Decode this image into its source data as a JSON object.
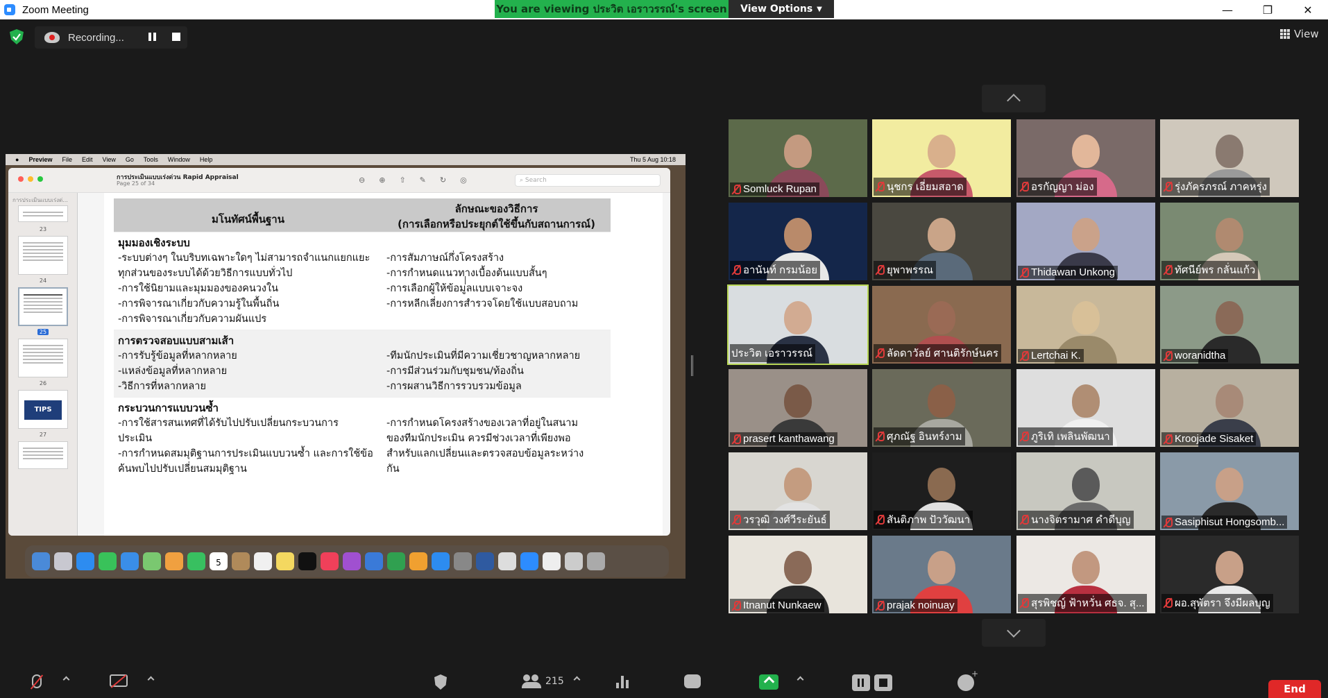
{
  "window": {
    "title": "Zoom Meeting",
    "minimize": "—",
    "restore": "❐",
    "close": "✕"
  },
  "banner": {
    "viewing_text": "You are viewing ประวิต  เอราวรรณ์'s screen",
    "view_options": "View Options",
    "viewing_color": "#23b14d"
  },
  "recording": {
    "label": "Recording..."
  },
  "view_button": "View",
  "shared_screen": {
    "menubar": {
      "apple": "",
      "items": [
        "Preview",
        "File",
        "Edit",
        "View",
        "Go",
        "Tools",
        "Window",
        "Help"
      ],
      "clock": "Thu 5 Aug  10:18"
    },
    "document_title": "การประเมินแบบเร่งด่วน Rapid Appraisal",
    "page_info": "Page 25 of 34",
    "search_placeholder": "Search",
    "sidebar_label": "การประเมินแบบเร่งด่...",
    "thumbnails": [
      {
        "num": "23",
        "selected": false
      },
      {
        "num": "24",
        "selected": false
      },
      {
        "num": "25",
        "selected": true
      },
      {
        "num": "26",
        "selected": false
      },
      {
        "num": "27",
        "selected": false
      }
    ],
    "tips_label": "TIPS",
    "table": {
      "header_left": "มโนทัศน์พื้นฐาน",
      "header_right_1": "ลักษณะของวิธีการ",
      "header_right_2": "(การเลือกหรือประยุกต์ใช้ขึ้นกับสถานการณ์)",
      "sections": [
        {
          "head": "มุมมองเชิงระบบ",
          "left": [
            " -ระบบต่างๆ ในบริบทเฉพาะใดๆ ไม่สามารถจำแนกแยกแยะ",
            "ทุกส่วนของระบบได้ด้วยวิธีการแบบทั่วไป",
            "-การใช้นิยามและมุมมองของคนวงใน",
            "-การพิจารณาเกี่ยวกับความรู้ในพื้นถิ่น",
            "-การพิจารณาเกี่ยวกับความผันแปร"
          ],
          "right": [
            "-การสัมภาษณ์กึ่งโครงสร้าง",
            "-การกำหนดแนวทางเบื้องต้นแบบสั้นๆ",
            "-การเลือกผู้ให้ข้อมูลแบบเจาะจง",
            "-การหลีกเลี่ยงการสำรวจโดยใช้แบบสอบถาม"
          ]
        },
        {
          "head": "การตรวจสอบแบบสามเส้า",
          "left": [
            "-การรับรู้ข้อมูลที่หลากหลาย",
            "-แหล่งข้อมูลที่หลากหลาย",
            "-วิธีการที่หลากหลาย"
          ],
          "right": [
            "-ทีมนักประเมินที่มีความเชี่ยวชาญหลากหลาย",
            "-การมีส่วนร่วมกับชุมชน/ท้องถิ่น",
            "-การผสานวิธีการรวบรวมข้อมูล"
          ]
        },
        {
          "head": "กระบวนการแบบวนซ้ำ",
          "left": [
            "-การใช้สารสนเทศที่ได้รับไปปรับเปลี่ยนกระบวนการ",
            "ประเมิน",
            "-การกำหนดสมมุติฐานการประเมินแบบวนซ้ำ และการใช้ข้อ",
            "ค้นพบไปปรับเปลี่ยนสมมุติฐาน"
          ],
          "right": [
            "-การกำหนดโครงสร้างของเวลาที่อยู่ในสนาม",
            "ของทีมนักประเมิน ควรมีช่วงเวลาที่เพียงพอ",
            "สำหรับแลกเปลี่ยนและตรวจสอบข้อมูลระหว่าง",
            "กัน"
          ]
        }
      ]
    },
    "dock_calendar_day": "5"
  },
  "participants": [
    {
      "name": "Somluck Rupan",
      "muted": true,
      "bg": "#5c6a4a",
      "face": "#c49a80",
      "body": "#8a4a5a",
      "active": false
    },
    {
      "name": "นุชกร เอี่ยมสอาด",
      "muted": true,
      "bg": "#f2eca0",
      "face": "#d9b08c",
      "body": "#c75a6a",
      "active": false
    },
    {
      "name": "อรกัญญา  ม่อง",
      "muted": true,
      "bg": "#7a6a68",
      "face": "#e2b79a",
      "body": "#d66a8a",
      "active": false
    },
    {
      "name": "รุ่งภัครภรณ์ ภาคหรุ่ง",
      "muted": true,
      "bg": "#cfc8bc",
      "face": "#8a7a70",
      "body": "#9a9a9a",
      "active": false
    },
    {
      "name": "อานันท์ กรมน้อย",
      "muted": true,
      "bg": "#14264a",
      "face": "#b98a6a",
      "body": "#e8e8e8",
      "active": false
    },
    {
      "name": "ยุพาพรรณ",
      "muted": true,
      "bg": "#4a4840",
      "face": "#c9a488",
      "body": "#5a6a7a",
      "active": false
    },
    {
      "name": "Thidawan Unkong",
      "muted": true,
      "bg": "#a3a8c4",
      "face": "#caa28a",
      "body": "#3a3a4a",
      "active": false
    },
    {
      "name": "ทัศนีย์พร  กลั่นแก้ว",
      "muted": true,
      "bg": "#7a8a72",
      "face": "#b08a70",
      "body": "#d4c8b8",
      "active": false
    },
    {
      "name": "ประวิต  เอราวรรณ์",
      "muted": false,
      "bg": "#d9dde0",
      "face": "#d2ab92",
      "body": "#2a3244",
      "active": true
    },
    {
      "name": "ลัดดาวัลย์ ศานติรักษ์นคร",
      "muted": true,
      "bg": "#8a6a50",
      "face": "#9a6a55",
      "body": "#b05050",
      "active": false
    },
    {
      "name": "Lertchai K.",
      "muted": true,
      "bg": "#c8b89a",
      "face": "#d8c098",
      "body": "#9a8a6a",
      "active": false
    },
    {
      "name": "woranidtha",
      "muted": true,
      "bg": "#8c9a88",
      "face": "#8a6a58",
      "body": "#2a2a2a",
      "active": false
    },
    {
      "name": "prasert kanthawang",
      "muted": true,
      "bg": "#9a9088",
      "face": "#7a5a48",
      "body": "#3a3a3a",
      "active": false
    },
    {
      "name": "ศุภณัฐ อินทร์งาม",
      "muted": true,
      "bg": "#6a6a5a",
      "face": "#8a6048",
      "body": "#a8a8a0",
      "active": false
    },
    {
      "name": "ภูริเทิ เพลินพัฒนา",
      "muted": true,
      "bg": "#dedede",
      "face": "#b08e74",
      "body": "#f0f0f0",
      "active": false
    },
    {
      "name": "Kroojade Sisaket",
      "muted": true,
      "bg": "#b8b0a0",
      "face": "#a88a78",
      "body": "#3a3e4a",
      "active": false
    },
    {
      "name": "วรวุฒิ วงศ์วีระยันธ์",
      "muted": true,
      "bg": "#d8d6d0",
      "face": "#c49c80",
      "body": "#e2e2e2",
      "active": false
    },
    {
      "name": "สันติภาพ ปัววัฒนา",
      "muted": true,
      "bg": "#1e1e1e",
      "face": "#8a6a50",
      "body": "#e0e0e0",
      "active": false
    },
    {
      "name": "นางจิตรามาศ คำดีบุญ",
      "muted": true,
      "bg": "#c8c8c0",
      "face": "#5a5a5a",
      "body": "#6a6a6a",
      "active": false
    },
    {
      "name": "Sasiphisut Hongsomb...",
      "muted": true,
      "bg": "#8a9aa8",
      "face": "#c8a088",
      "body": "#2a2a2a",
      "active": false
    },
    {
      "name": "Itnanut Nunkaew",
      "muted": true,
      "bg": "#e8e4dc",
      "face": "#8a6a58",
      "body": "#2a2a2a",
      "active": false
    },
    {
      "name": "prajak noinuay",
      "muted": true,
      "bg": "#6a7a8a",
      "face": "#c8a088",
      "body": "#e04040",
      "active": false
    },
    {
      "name": "สุรพิชญ์ ฟ้าหวั่น ศธจ. สุ...",
      "muted": true,
      "bg": "#ece8e4",
      "face": "#c29880",
      "body": "#b83040",
      "active": false
    },
    {
      "name": "ผอ.สุพัตรา จึงมีผลบุญ",
      "muted": true,
      "bg": "#2a2a2a",
      "face": "#c8a088",
      "body": "#e8e8e8",
      "active": false
    }
  ],
  "toolbar": {
    "participants_count": "215",
    "end_label": "End",
    "end_color": "#e02828"
  }
}
